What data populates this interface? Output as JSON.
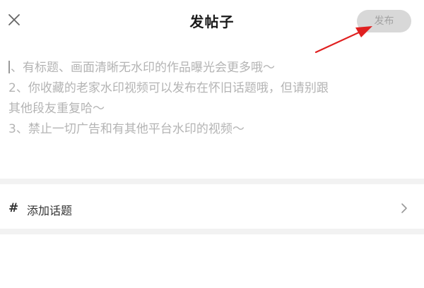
{
  "header": {
    "close_icon": "close-icon",
    "title": "发帖子",
    "publish_label": "发布",
    "publish_bg": "#d8d8d8",
    "publish_fg": "#a2a2a2"
  },
  "annotation": {
    "arrow_color": "#e02020"
  },
  "composer": {
    "placeholder_lines": [
      "、有标题、画面清晰无水印的作品曝光会更多哦～",
      "2、你收藏的老家水印视频可以发布在怀旧话题哦，但请别跟",
      "其他段友重复哈～",
      "3、禁止一切广告和有其他平台水印的视频～"
    ]
  },
  "topic": {
    "hash_symbol": "#",
    "label": "添加话题",
    "chevron_icon": "chevron-right-icon"
  }
}
